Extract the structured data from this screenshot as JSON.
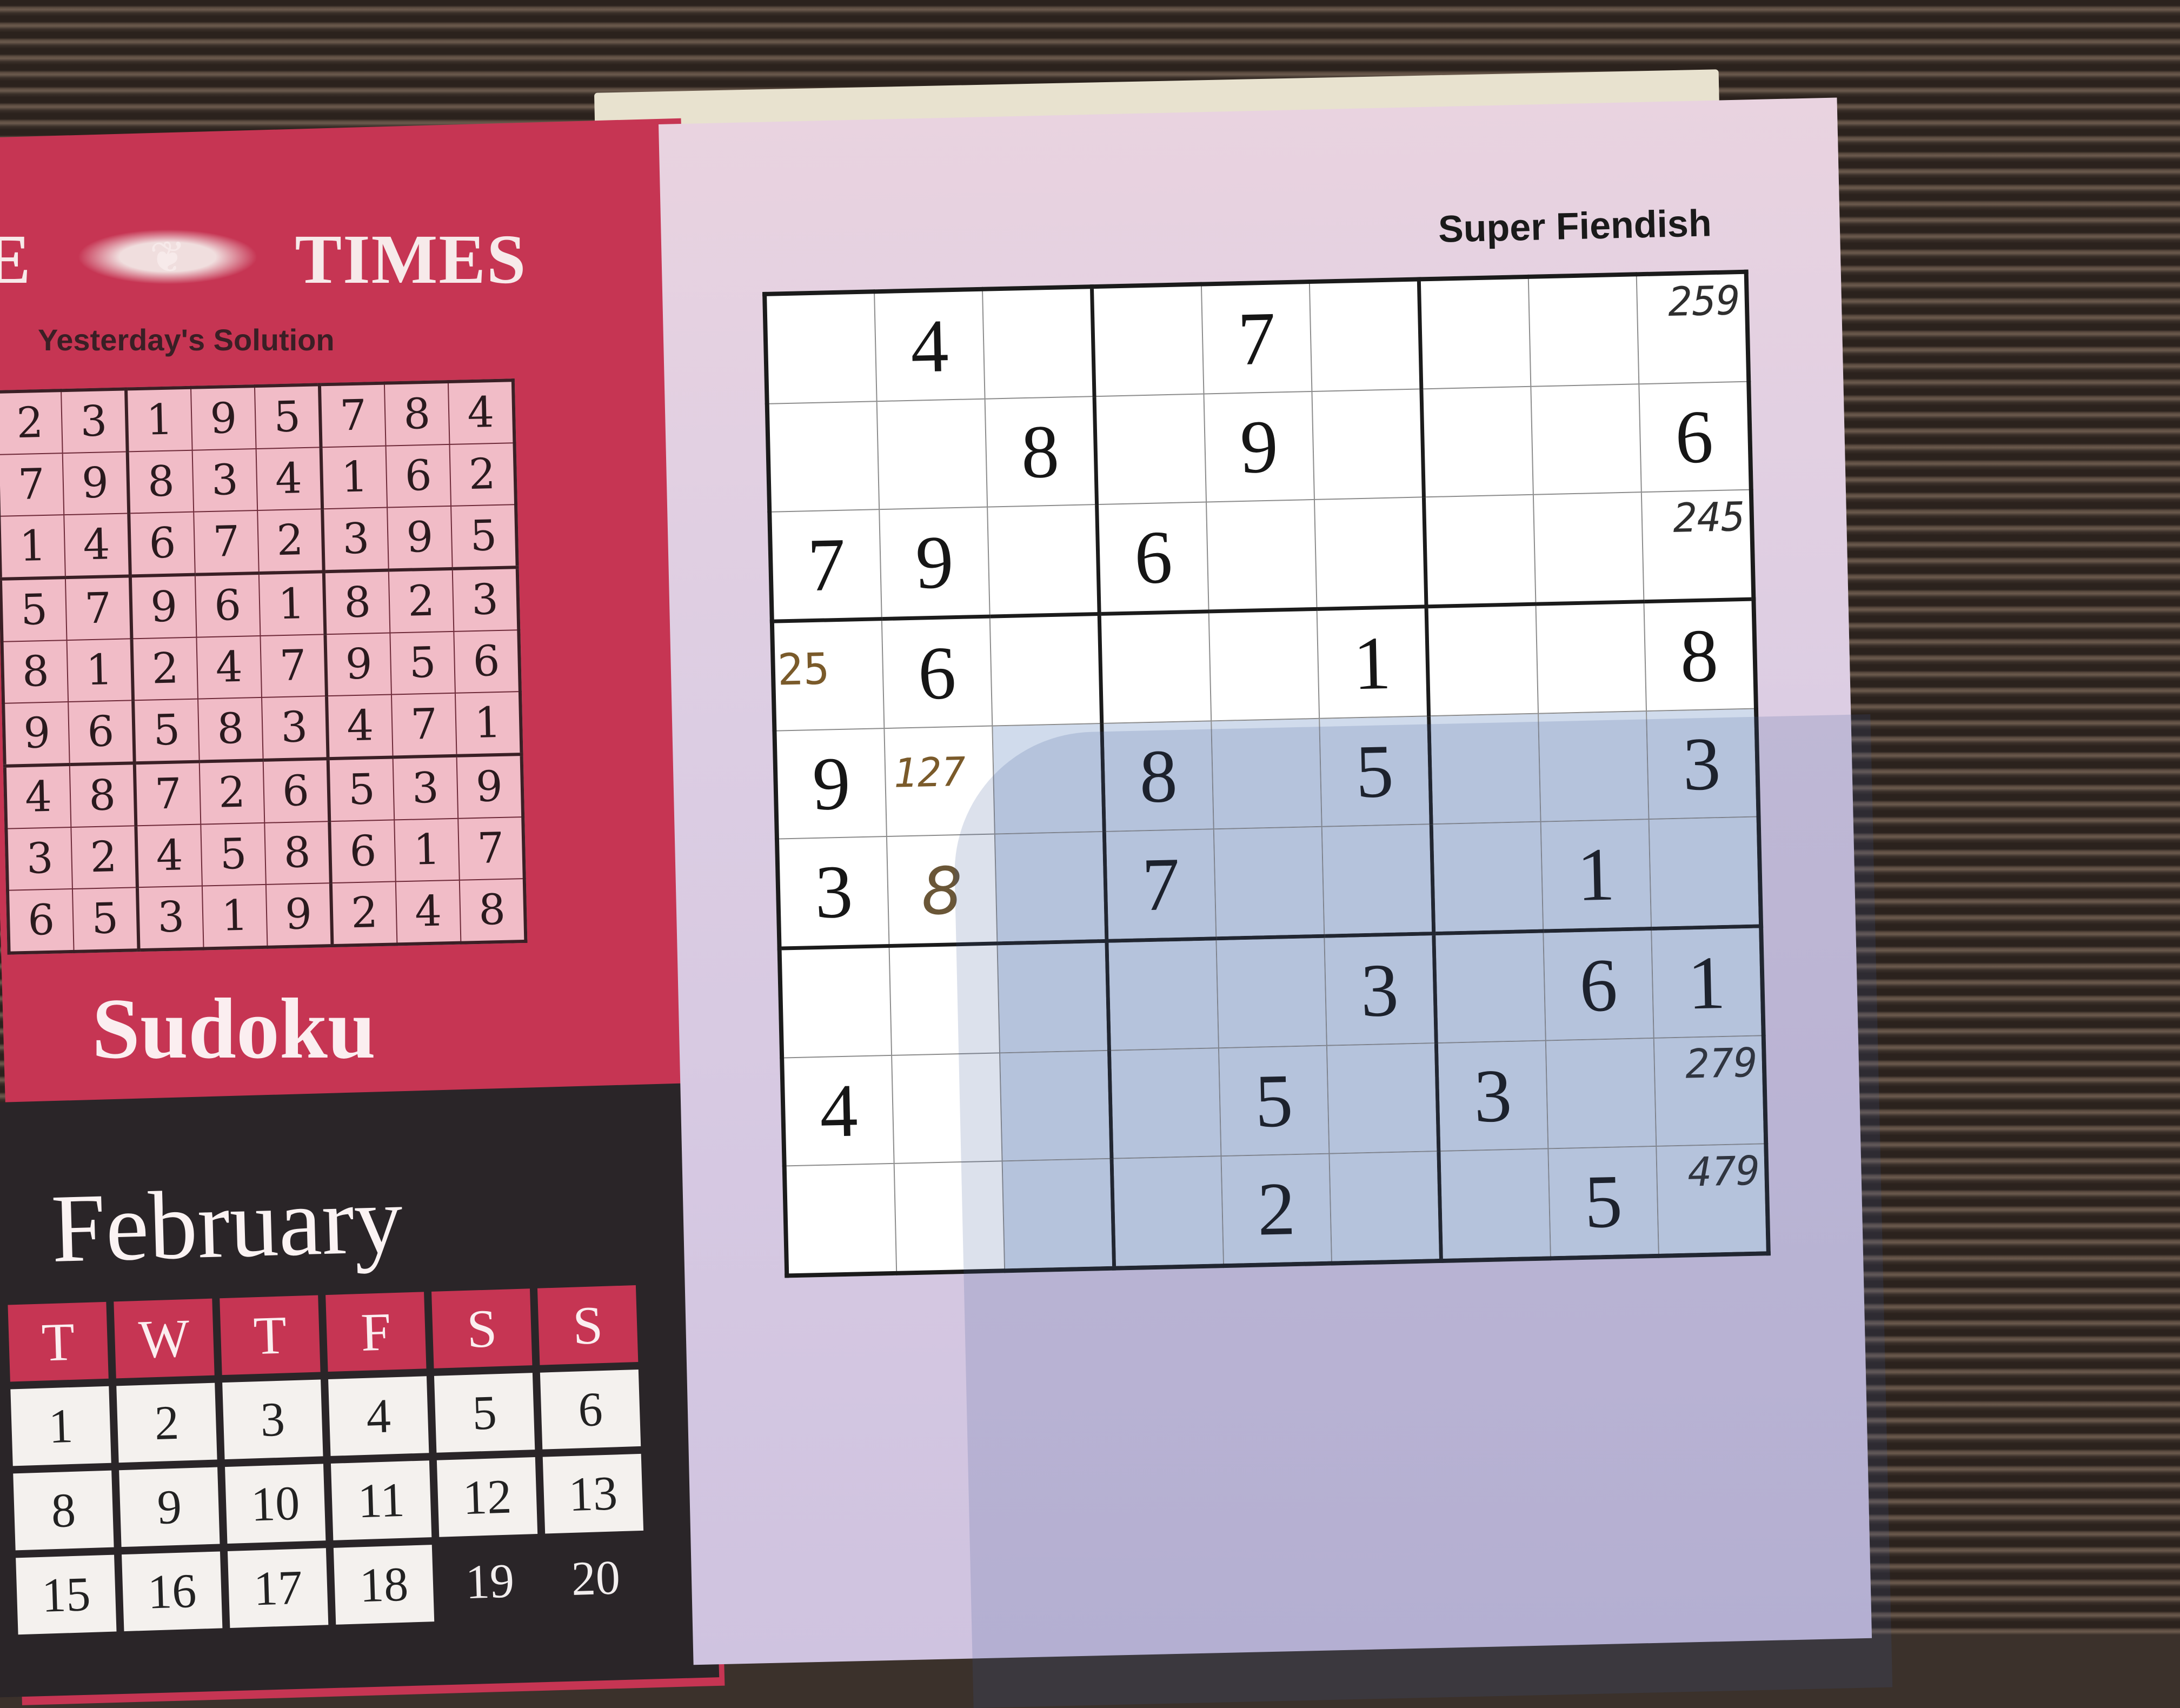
{
  "header": {
    "masthead": "E",
    "masthead_tail": "TIMES",
    "solution_label": "Yesterday's Solution",
    "section_label": "Sudoku",
    "month": "February",
    "difficulty": "Super Fiendish"
  },
  "solution_grid": [
    [
      "2",
      "3",
      "1",
      "9",
      "5",
      "7",
      "8",
      "4"
    ],
    [
      "7",
      "9",
      "8",
      "3",
      "4",
      "1",
      "6",
      "2"
    ],
    [
      "1",
      "4",
      "6",
      "7",
      "2",
      "3",
      "9",
      "5"
    ],
    [
      "5",
      "7",
      "9",
      "6",
      "1",
      "8",
      "2",
      "3"
    ],
    [
      "8",
      "1",
      "2",
      "4",
      "7",
      "9",
      "5",
      "6"
    ],
    [
      "9",
      "6",
      "5",
      "8",
      "3",
      "4",
      "7",
      "1"
    ],
    [
      "4",
      "8",
      "7",
      "2",
      "6",
      "5",
      "3",
      "9"
    ],
    [
      "3",
      "2",
      "4",
      "5",
      "8",
      "6",
      "1",
      "7"
    ],
    [
      "6",
      "5",
      "3",
      "1",
      "9",
      "2",
      "4",
      "8"
    ]
  ],
  "calendar": {
    "days": [
      "T",
      "W",
      "T",
      "F",
      "S",
      "S"
    ],
    "rows": [
      [
        "1",
        "2",
        "3",
        "4",
        "5",
        "6"
      ],
      [
        "8",
        "9",
        "10",
        "11",
        "12",
        "13"
      ],
      [
        "15",
        "16",
        "17",
        "18",
        "19",
        "20"
      ]
    ]
  },
  "puzzle": {
    "rows": [
      [
        {
          "v": ""
        },
        {
          "v": "4",
          "t": "given"
        },
        {
          "v": ""
        },
        {
          "v": ""
        },
        {
          "v": "7",
          "t": "given"
        },
        {
          "v": ""
        },
        {
          "v": ""
        },
        {
          "v": ""
        },
        {
          "v": "",
          "corner": "259"
        }
      ],
      [
        {
          "v": ""
        },
        {
          "v": ""
        },
        {
          "v": "8",
          "t": "given"
        },
        {
          "v": ""
        },
        {
          "v": "9",
          "t": "given"
        },
        {
          "v": ""
        },
        {
          "v": ""
        },
        {
          "v": ""
        },
        {
          "v": "6",
          "t": "given"
        }
      ],
      [
        {
          "v": "7",
          "t": "given"
        },
        {
          "v": "9",
          "t": "given"
        },
        {
          "v": ""
        },
        {
          "v": "6",
          "t": "given"
        },
        {
          "v": ""
        },
        {
          "v": ""
        },
        {
          "v": ""
        },
        {
          "v": ""
        },
        {
          "v": "",
          "corner": "245"
        }
      ],
      [
        {
          "v": "",
          "left": "25"
        },
        {
          "v": "6",
          "t": "given"
        },
        {
          "v": ""
        },
        {
          "v": ""
        },
        {
          "v": ""
        },
        {
          "v": "1",
          "t": "given"
        },
        {
          "v": ""
        },
        {
          "v": ""
        },
        {
          "v": "8",
          "t": "given"
        }
      ],
      [
        {
          "v": "9",
          "t": "given"
        },
        {
          "v": "",
          "top": "127"
        },
        {
          "v": ""
        },
        {
          "v": "8",
          "t": "given"
        },
        {
          "v": ""
        },
        {
          "v": "5",
          "t": "given"
        },
        {
          "v": ""
        },
        {
          "v": ""
        },
        {
          "v": "3",
          "t": "given"
        }
      ],
      [
        {
          "v": "3",
          "t": "given"
        },
        {
          "v": "8",
          "t": "inked"
        },
        {
          "v": ""
        },
        {
          "v": "7",
          "t": "given"
        },
        {
          "v": ""
        },
        {
          "v": ""
        },
        {
          "v": ""
        },
        {
          "v": "1",
          "t": "given"
        },
        {
          "v": ""
        }
      ],
      [
        {
          "v": ""
        },
        {
          "v": ""
        },
        {
          "v": ""
        },
        {
          "v": ""
        },
        {
          "v": ""
        },
        {
          "v": "3",
          "t": "given"
        },
        {
          "v": ""
        },
        {
          "v": "6",
          "t": "given"
        },
        {
          "v": "1",
          "t": "given"
        }
      ],
      [
        {
          "v": "4",
          "t": "given"
        },
        {
          "v": ""
        },
        {
          "v": ""
        },
        {
          "v": ""
        },
        {
          "v": "5",
          "t": "given"
        },
        {
          "v": ""
        },
        {
          "v": "3",
          "t": "given"
        },
        {
          "v": ""
        },
        {
          "v": "",
          "corner": "279"
        }
      ],
      [
        {
          "v": ""
        },
        {
          "v": ""
        },
        {
          "v": ""
        },
        {
          "v": ""
        },
        {
          "v": "2",
          "t": "given"
        },
        {
          "v": ""
        },
        {
          "v": ""
        },
        {
          "v": "5",
          "t": "given"
        },
        {
          "v": "",
          "corner": "479"
        }
      ]
    ]
  }
}
